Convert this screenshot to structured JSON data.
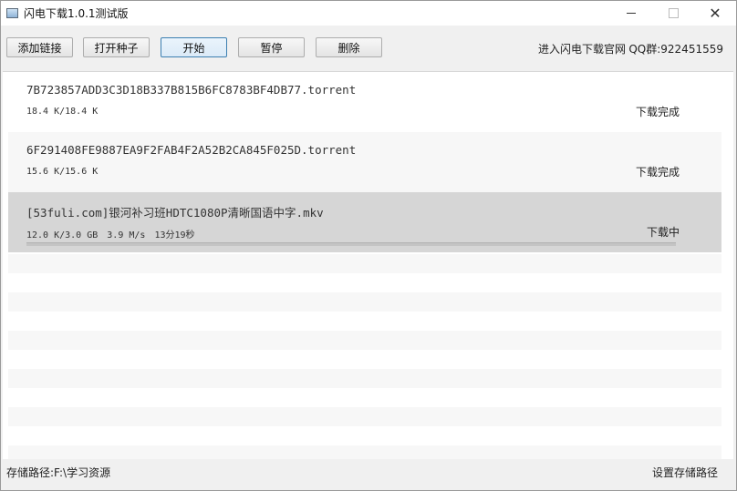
{
  "window": {
    "title": "闪电下载1.0.1测试版"
  },
  "toolbar": {
    "add_link": "添加链接",
    "open_seed": "打开种子",
    "start": "开始",
    "pause": "暂停",
    "delete": "删除",
    "site_link": "进入闪电下载官网",
    "qq_group": "QQ群:922451559"
  },
  "downloads": [
    {
      "name": "7B723857ADD3C3D18B337B815B6FC8783BF4DB77.torrent",
      "size": "18.4 K/18.4 K",
      "speed": "",
      "eta": "",
      "status": "下载完成"
    },
    {
      "name": "6F291408FE9887EA9F2FAB4F2A52B2CA845F025D.torrent",
      "size": "15.6 K/15.6 K",
      "speed": "",
      "eta": "",
      "status": "下载完成"
    },
    {
      "name": "[53fuli.com]银河补习班HDTC1080P清晰国语中字.mkv",
      "size": "12.0 K/3.0 GB",
      "speed": "3.9 M/s",
      "eta": "13分19秒",
      "status": "下载中",
      "progress": 0.0
    }
  ],
  "statusbar": {
    "save_path": "存储路径:F:\\学习资源",
    "set_path": "设置存储路径"
  },
  "colors": {
    "selected_row": "#d6d6d6",
    "active_button_border": "#3c7fb1"
  }
}
